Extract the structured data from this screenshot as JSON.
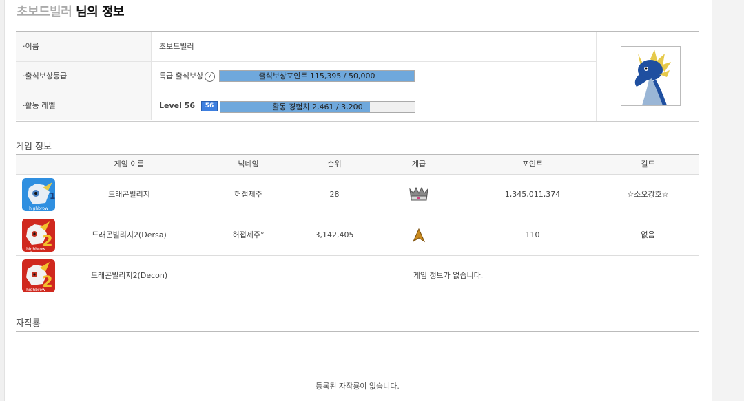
{
  "header": {
    "user_name": "초보드빌러",
    "title_suffix": " 님의 정보"
  },
  "profile": {
    "name_label": "·이름",
    "name_value": "초보드빌러",
    "grade_label": "·출석보상등급",
    "grade_value": "특급 출석보상",
    "grade_help": "?",
    "attend_bar_text": "출석보상포인트 115,395 / 50,000",
    "attend_progress": 1.0,
    "level_label": "·활동 레벨",
    "level_value": "Level 56",
    "level_badge": "56",
    "exp_bar_text": "활동 경험치 2,461 / 3,200",
    "exp_progress": 0.769
  },
  "game_info": {
    "section_title": "게임 정보",
    "headers": [
      "게임 이름",
      "닉네임",
      "순위",
      "계급",
      "포인트",
      "길드"
    ],
    "rows": [
      {
        "game": "드래곤빌리지",
        "nickname": "허접제주",
        "rank": "28",
        "class_icon": "crown-icon",
        "points": "1,345,011,374",
        "guild": "☆소오강호☆",
        "game_icon": "dragon-village-1-icon"
      },
      {
        "game": "드래곤빌리지2(Dersa)",
        "nickname": "허접제주°",
        "rank": "3,142,405",
        "class_icon": "arrow-rank-icon",
        "points": "110",
        "guild": "없음",
        "game_icon": "dragon-village-2-icon"
      },
      {
        "game": "드래곤빌리지2(Decon)",
        "no_info": "게임 정보가 없습니다.",
        "game_icon": "dragon-village-2-icon"
      }
    ]
  },
  "selfmade": {
    "section_title": "자작룡",
    "empty_text": "등록된 자작룡이 없습니다."
  },
  "colors": {
    "bar_fill": "#6fa8dc",
    "badge": "#3d7fe0"
  }
}
